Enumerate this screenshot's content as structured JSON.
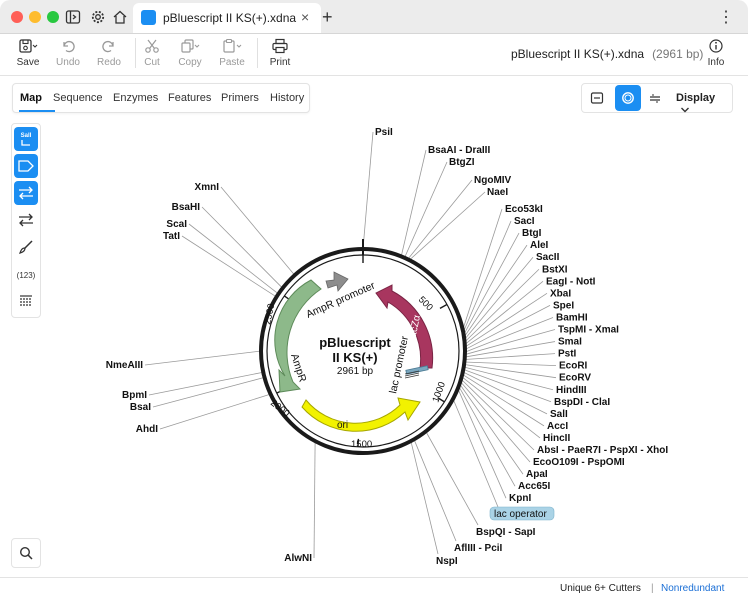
{
  "window": {
    "tab_title": "pBluescript II KS(+).xdna",
    "kebab": "⋮",
    "new_tab": "+",
    "close": "×"
  },
  "toolbar": {
    "save": "Save",
    "undo": "Undo",
    "redo": "Redo",
    "cut": "Cut",
    "copy": "Copy",
    "paste": "Paste",
    "print": "Print",
    "info": "Info",
    "file_name": "pBluescript II KS(+).xdna",
    "file_length": "(2961 bp)"
  },
  "nav_tabs": [
    "Map",
    "Sequence",
    "Enzymes",
    "Features",
    "Primers",
    "History"
  ],
  "view": {
    "display_label": "Display"
  },
  "side_tools": {
    "sali_label": "SalI",
    "number_label": "(123)"
  },
  "map": {
    "name_line1": "pBluescript",
    "name_line2": "II KS(+)",
    "length": "2961 bp",
    "ticks": [
      "500",
      "1000",
      "1500",
      "2000",
      "2500"
    ],
    "features": {
      "ampr_promoter": "AmpR promoter",
      "ampr": "AmpR",
      "lacza": "lacZα",
      "lac_promoter": "lac promoter",
      "ori": "ori",
      "lac_operator": "lac operator"
    },
    "left_enzymes": [
      "XmnI",
      "BsaHI",
      "ScaI",
      "TatI",
      "NmeAIII",
      "BpmI",
      "BsaI",
      "AhdI",
      "AlwNI"
    ],
    "top_enzymes": [
      "PsiI",
      "BsaAI - DraIII",
      "BtgZI",
      "NgoMIV",
      "NaeI"
    ],
    "right_enzymes": [
      "Eco53kI",
      "SacI",
      "BtgI",
      "AleI",
      "SacII",
      "BstXI",
      "EagI - NotI",
      "XbaI",
      "SpeI",
      "BamHI",
      "TspMI - XmaI",
      "SmaI",
      "PstI",
      "EcoRI",
      "EcoRV",
      "HindIII",
      "BspDI - ClaI",
      "SalI",
      "AccI",
      "HincII",
      "AbsI - PaeR7I - PspXI - XhoI",
      "EcoO109I - PspOMI",
      "ApaI",
      "Acc65I",
      "KpnI"
    ],
    "bottom_enzymes": [
      "BspQI - SapI",
      "AflIII - PciI",
      "NspI"
    ]
  },
  "status": {
    "cutters": "Unique 6+ Cutters",
    "separator": "|",
    "mode": "Nonredundant"
  },
  "colors": {
    "accent": "#1b8ef2",
    "ampr": "#8db98a",
    "lacza": "#a8365f",
    "ori": "#f2f200",
    "lac_operator": "#aad3e6"
  }
}
